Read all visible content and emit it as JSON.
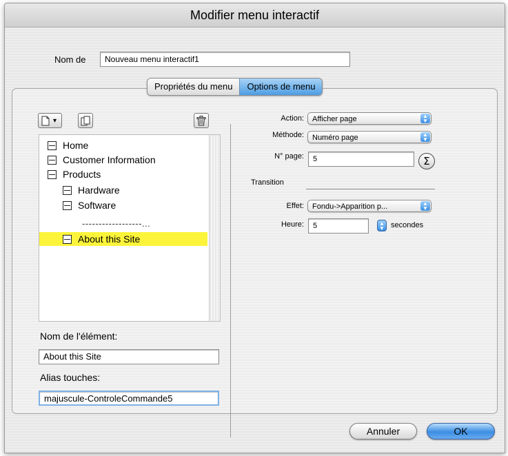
{
  "window": {
    "title": "Modifier menu interactif"
  },
  "name_field": {
    "label": "Nom de",
    "value": "Nouveau menu interactif1"
  },
  "tabs": [
    {
      "label": "Propriétés du menu",
      "selected": false
    },
    {
      "label": "Options de menu",
      "selected": true
    }
  ],
  "toolbar": {
    "new_item_icon": "new-document-icon",
    "dropdown_arrow": "▾",
    "duplicate_icon": "duplicate-icon",
    "delete_icon": "trash-icon"
  },
  "tree": {
    "items": [
      {
        "label": "Home",
        "level": 0
      },
      {
        "label": "Customer Information",
        "level": 0
      },
      {
        "label": "Products",
        "level": 0
      },
      {
        "label": "Hardware",
        "level": 1
      },
      {
        "label": "Software",
        "level": 1
      },
      {
        "label": "About this Site",
        "level": 1,
        "selected": true
      }
    ],
    "divider": "------------------..."
  },
  "element": {
    "name_label": "Nom de l'élément:",
    "name_value": "About this Site",
    "shortcut_label": "Alias touches:",
    "shortcut_value": "majuscule-ControleCommande5"
  },
  "options": {
    "action_label": "Action:",
    "action_value": "Afficher page",
    "method_label": "Méthode:",
    "method_value": "Numéro page",
    "page_label": "N° page:",
    "page_value": "5",
    "sigma_symbol": "Σ",
    "transition_label": "Transition",
    "effect_label": "Effet:",
    "effect_value": "Fondu->Apparition p...",
    "time_label": "Heure:",
    "time_value": "5",
    "time_unit": "secondes"
  },
  "buttons": {
    "cancel": "Annuler",
    "ok": "OK"
  },
  "colors": {
    "selection": "#fcf43a",
    "accent": "#3c8ee2"
  }
}
